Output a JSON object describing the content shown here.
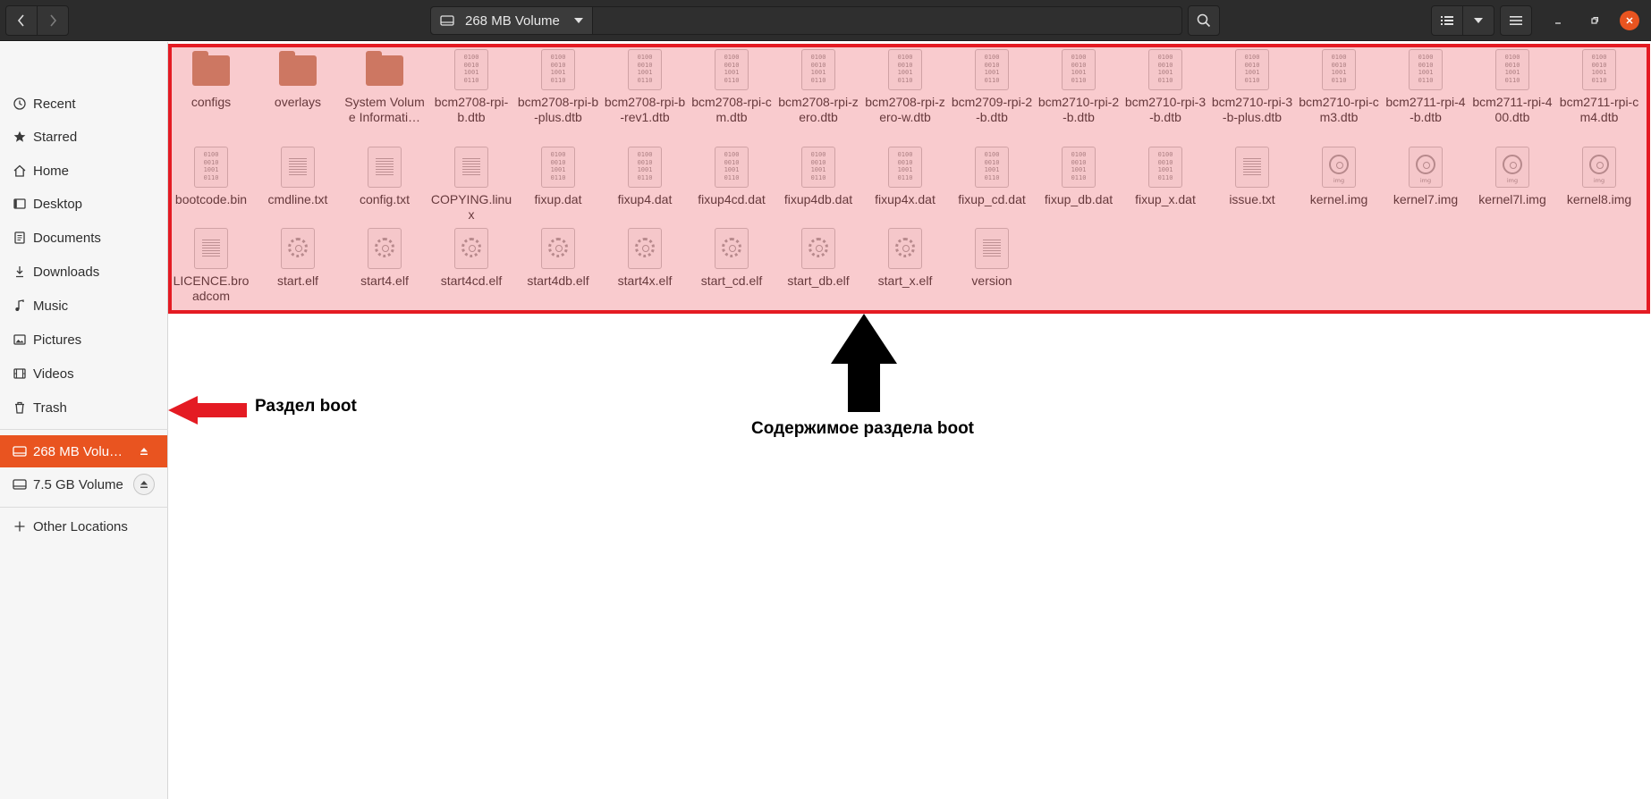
{
  "window": {
    "title": "268 MB Volume",
    "controls": [
      "minimize-icon",
      "maximize-icon",
      "close-icon"
    ],
    "accent": "#e95420"
  },
  "header": {
    "path_label": "268 MB Volume",
    "icons": {
      "back": "chevron-left-icon",
      "forward": "chevron-right-icon",
      "search": "search-icon",
      "view_list": "list-view-icon",
      "view_options": "caret-down-icon",
      "menu": "hamburger-menu-icon"
    }
  },
  "sidebar": {
    "places": [
      {
        "label": "Recent",
        "icon": "clock-icon"
      },
      {
        "label": "Starred",
        "icon": "star-icon"
      },
      {
        "label": "Home",
        "icon": "home-icon"
      },
      {
        "label": "Desktop",
        "icon": "desktop-icon"
      },
      {
        "label": "Documents",
        "icon": "document-icon"
      },
      {
        "label": "Downloads",
        "icon": "download-icon"
      },
      {
        "label": "Music",
        "icon": "music-icon"
      },
      {
        "label": "Pictures",
        "icon": "picture-icon"
      },
      {
        "label": "Videos",
        "icon": "video-icon"
      },
      {
        "label": "Trash",
        "icon": "trash-icon"
      }
    ],
    "devices": [
      {
        "label": "268 MB Volu…",
        "icon": "drive-icon",
        "active": true
      },
      {
        "label": "7.5 GB Volume",
        "icon": "drive-icon",
        "active": false
      }
    ],
    "other": {
      "label": "Other Locations",
      "icon": "plus-icon"
    }
  },
  "files": [
    {
      "name": "configs",
      "type": "folder"
    },
    {
      "name": "overlays",
      "type": "folder"
    },
    {
      "name": "System Volume Informati…",
      "type": "folder"
    },
    {
      "name": "bcm2708-rpi-b.dtb",
      "type": "binary"
    },
    {
      "name": "bcm2708-rpi-b-plus.dtb",
      "type": "binary"
    },
    {
      "name": "bcm2708-rpi-b-rev1.dtb",
      "type": "binary"
    },
    {
      "name": "bcm2708-rpi-cm.dtb",
      "type": "binary"
    },
    {
      "name": "bcm2708-rpi-zero.dtb",
      "type": "binary"
    },
    {
      "name": "bcm2708-rpi-zero-w.dtb",
      "type": "binary"
    },
    {
      "name": "bcm2709-rpi-2-b.dtb",
      "type": "binary"
    },
    {
      "name": "bcm2710-rpi-2-b.dtb",
      "type": "binary"
    },
    {
      "name": "bcm2710-rpi-3-b.dtb",
      "type": "binary"
    },
    {
      "name": "bcm2710-rpi-3-b-plus.dtb",
      "type": "binary"
    },
    {
      "name": "bcm2710-rpi-cm3.dtb",
      "type": "binary"
    },
    {
      "name": "bcm2711-rpi-4-b.dtb",
      "type": "binary"
    },
    {
      "name": "bcm2711-rpi-400.dtb",
      "type": "binary"
    },
    {
      "name": "bcm2711-rpi-cm4.dtb",
      "type": "binary"
    },
    {
      "name": "bootcode.bin",
      "type": "binary"
    },
    {
      "name": "cmdline.txt",
      "type": "text"
    },
    {
      "name": "config.txt",
      "type": "text"
    },
    {
      "name": "COPYING.linux",
      "type": "text"
    },
    {
      "name": "fixup.dat",
      "type": "binary"
    },
    {
      "name": "fixup4.dat",
      "type": "binary"
    },
    {
      "name": "fixup4cd.dat",
      "type": "binary"
    },
    {
      "name": "fixup4db.dat",
      "type": "binary"
    },
    {
      "name": "fixup4x.dat",
      "type": "binary"
    },
    {
      "name": "fixup_cd.dat",
      "type": "binary"
    },
    {
      "name": "fixup_db.dat",
      "type": "binary"
    },
    {
      "name": "fixup_x.dat",
      "type": "binary"
    },
    {
      "name": "issue.txt",
      "type": "text"
    },
    {
      "name": "kernel.img",
      "type": "image"
    },
    {
      "name": "kernel7.img",
      "type": "image"
    },
    {
      "name": "kernel7l.img",
      "type": "image"
    },
    {
      "name": "kernel8.img",
      "type": "image"
    },
    {
      "name": "LICENCE.broadcom",
      "type": "text"
    },
    {
      "name": "start.elf",
      "type": "executable"
    },
    {
      "name": "start4.elf",
      "type": "executable"
    },
    {
      "name": "start4cd.elf",
      "type": "executable"
    },
    {
      "name": "start4db.elf",
      "type": "executable"
    },
    {
      "name": "start4x.elf",
      "type": "executable"
    },
    {
      "name": "start_cd.elf",
      "type": "executable"
    },
    {
      "name": "start_db.elf",
      "type": "executable"
    },
    {
      "name": "start_x.elf",
      "type": "executable"
    },
    {
      "name": "version",
      "type": "text"
    }
  ],
  "icon_glyph": {
    "binary": "0100\n0010\n1001\n0110",
    "image": "img"
  },
  "annotations": {
    "boot_partition_label": "Раздел boot",
    "boot_content_label": "Содержимое раздела boot",
    "highlight_color": "#e41b23",
    "arrow_left_color": "#e41b23",
    "arrow_up_color": "#000000"
  }
}
